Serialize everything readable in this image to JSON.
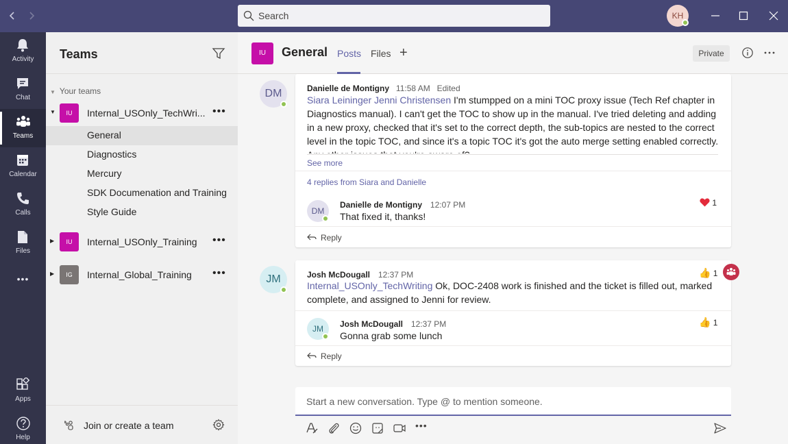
{
  "titlebar": {
    "search_placeholder": "Search",
    "user_initials": "KH",
    "accent": "#464775"
  },
  "rail": {
    "items": [
      {
        "label": "Activity",
        "icon": "bell-icon"
      },
      {
        "label": "Chat",
        "icon": "chat-icon"
      },
      {
        "label": "Teams",
        "icon": "teams-icon"
      },
      {
        "label": "Calendar",
        "icon": "calendar-icon"
      },
      {
        "label": "Calls",
        "icon": "phone-icon"
      },
      {
        "label": "Files",
        "icon": "file-icon"
      }
    ],
    "more": "•••",
    "bottom": [
      {
        "label": "Apps",
        "icon": "apps-icon"
      },
      {
        "label": "Help",
        "icon": "help-icon"
      }
    ]
  },
  "teams_panel": {
    "title": "Teams",
    "section": "Your teams",
    "teams": [
      {
        "initials": "IU",
        "name": "Internal_USOnly_TechWri...",
        "color": "#c50fa8"
      },
      {
        "initials": "IU",
        "name": "Internal_USOnly_Training",
        "color": "#c50fa8"
      },
      {
        "initials": "IG",
        "name": "Internal_Global_Training",
        "color": "#7a7574"
      }
    ],
    "channels": [
      "General",
      "Diagnostics",
      "Mercury",
      "SDK Documenation and Training",
      "Style Guide"
    ],
    "more": "•••",
    "join_label": "Join or create a team"
  },
  "header": {
    "team_initials": "IU",
    "channel": "General",
    "tabs": [
      "Posts",
      "Files"
    ],
    "add": "+",
    "private": "Private"
  },
  "posts": [
    {
      "initials": "DM",
      "author": "Danielle de Montigny",
      "time": "11:58 AM",
      "edited": "Edited",
      "mentions": "Siara Leininger Jenni Christensen",
      "text": "I'm stumpped on a mini TOC proxy issue (Tech Ref chapter in Diagnostics manual). I can't get the TOC to show up in the manual. I've tried deleting and adding in a new proxy, checked that it's set to the correct depth, the sub-topics are nested to the correct level in the topic TOC, and since it's a topic TOC it's got the auto merge setting enabled correctly. Any other issues that you're aware of?",
      "see_more": "See more",
      "replies_summary": "4 replies from Siara and Danielle",
      "reply": {
        "initials": "DM",
        "author": "Danielle de Montigny",
        "time": "12:07 PM",
        "text": "That fixed it, thanks!",
        "reaction_count": "1"
      },
      "reply_label": "Reply"
    },
    {
      "initials": "JM",
      "author": "Josh McDougall",
      "time": "12:37 PM",
      "mentions": "Internal_USOnly_TechWriting",
      "text": "Ok, DOC-2408 work is finished and the ticket is filled out, marked complete, and assigned to Jenni for review.",
      "reaction_count": "1",
      "reply": {
        "initials": "JM",
        "author": "Josh McDougall",
        "time": "12:37 PM",
        "text": "Gonna grab some lunch",
        "reaction_count": "1"
      },
      "reply_label": "Reply"
    }
  ],
  "compose": {
    "placeholder": "Start a new conversation. Type @ to mention someone.",
    "more": "•••"
  }
}
